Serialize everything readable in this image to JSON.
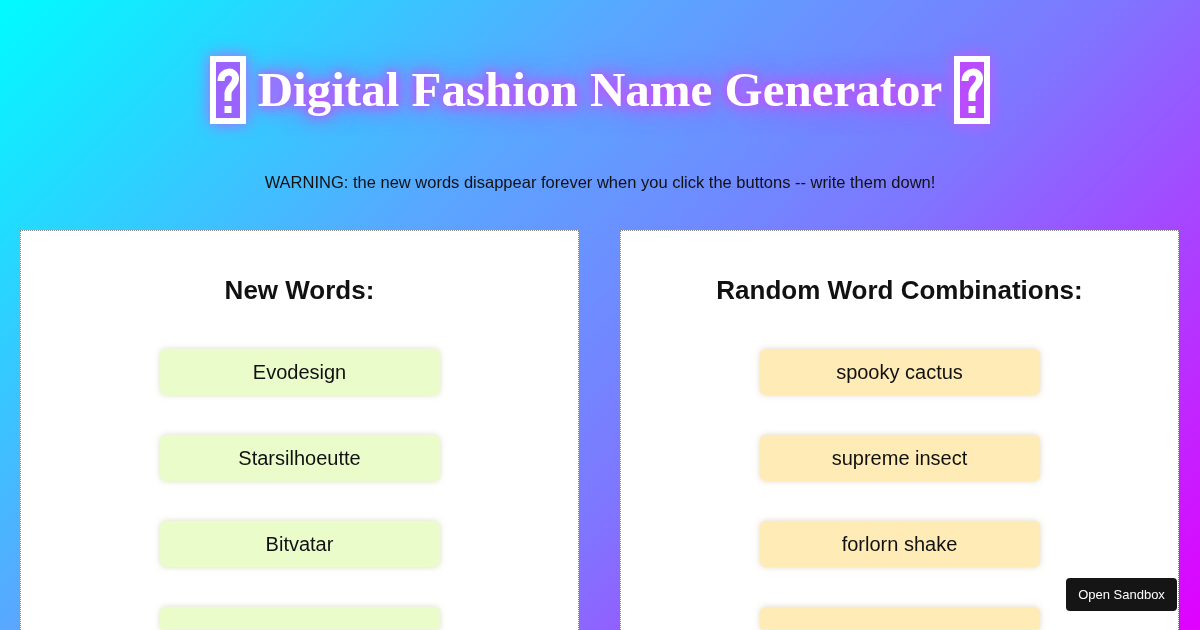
{
  "title": "Digital Fashion Name Generator",
  "warning": "WARNING: the new words disappear forever when you click the buttons -- write them down!",
  "panels": [
    {
      "kind": "words",
      "heading": "New Words:",
      "items": [
        "Evodesign",
        "Starsilhoeutte",
        "Bitvatar"
      ],
      "cut_off_item": true
    },
    {
      "kind": "combinations",
      "heading": "Random Word Combinations:",
      "items": [
        "spooky cactus",
        "supreme insect",
        "forlorn shake"
      ],
      "cut_off_item": true
    }
  ],
  "sandbox_button": "Open Sandbox"
}
